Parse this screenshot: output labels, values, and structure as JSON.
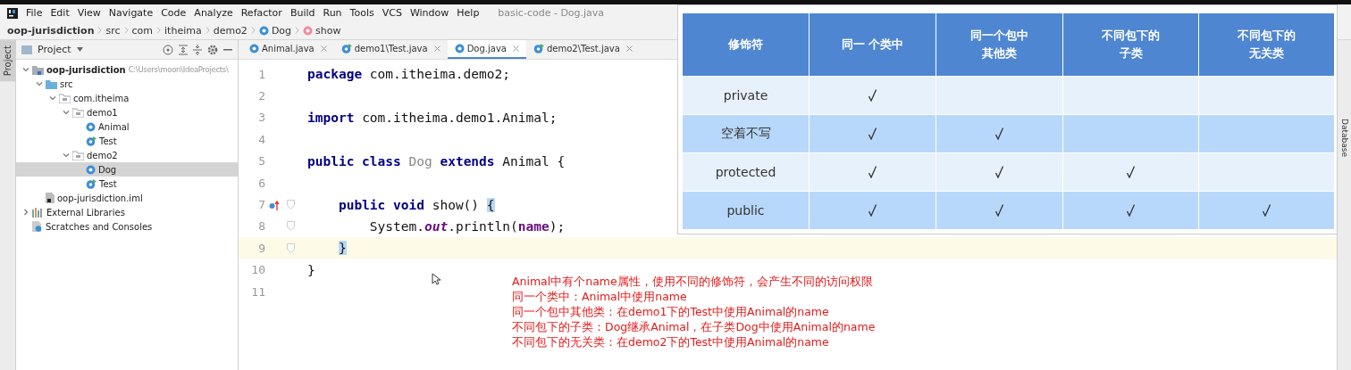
{
  "menu": [
    "File",
    "Edit",
    "View",
    "Navigate",
    "Code",
    "Analyze",
    "Refactor",
    "Build",
    "Run",
    "Tools",
    "VCS",
    "Window",
    "Help"
  ],
  "window": {
    "title": "basic-code - Dog.java"
  },
  "breadcrumb": [
    {
      "label": "oop-jurisdiction",
      "kind": "project"
    },
    {
      "label": "src",
      "kind": "dir"
    },
    {
      "label": "com",
      "kind": "dir"
    },
    {
      "label": "itheima",
      "kind": "dir"
    },
    {
      "label": "demo2",
      "kind": "dir"
    },
    {
      "label": "Dog",
      "kind": "class"
    },
    {
      "label": "show",
      "kind": "method"
    }
  ],
  "side_strip": {
    "label": "Project"
  },
  "right_strip": {
    "label": "Database"
  },
  "project_panel": {
    "title": "Project",
    "tree": [
      {
        "label": "oop-jurisdiction",
        "path": "C:\\Users\\moon\\IdeaProjects\\",
        "kind": "module",
        "expanded": true,
        "selected": false,
        "children": [
          {
            "label": "src",
            "kind": "source",
            "expanded": true,
            "selected": false,
            "children": [
              {
                "label": "com.itheima",
                "kind": "package",
                "expanded": true,
                "selected": false,
                "children": [
                  {
                    "label": "demo1",
                    "kind": "package",
                    "expanded": true,
                    "selected": false,
                    "children": [
                      {
                        "label": "Animal",
                        "kind": "class",
                        "selected": false
                      },
                      {
                        "label": "Test",
                        "kind": "main",
                        "selected": false
                      }
                    ]
                  },
                  {
                    "label": "demo2",
                    "kind": "package",
                    "expanded": true,
                    "selected": false,
                    "children": [
                      {
                        "label": "Dog",
                        "kind": "class",
                        "selected": true
                      },
                      {
                        "label": "Test",
                        "kind": "main",
                        "selected": false
                      }
                    ]
                  }
                ]
              }
            ]
          },
          {
            "label": "oop-jurisdiction.iml",
            "kind": "iml",
            "selected": false
          }
        ]
      },
      {
        "label": "External Libraries",
        "kind": "libraries",
        "expanded": false,
        "selected": false
      },
      {
        "label": "Scratches and Consoles",
        "kind": "scratches",
        "selected": false
      }
    ]
  },
  "tabs": [
    {
      "label": "Animal.java",
      "kind": "class",
      "selected": false
    },
    {
      "label": "demo1\\Test.java",
      "kind": "main",
      "selected": false
    },
    {
      "label": "Dog.java",
      "kind": "class",
      "selected": true
    },
    {
      "label": "demo2\\Test.java",
      "kind": "main",
      "selected": false
    }
  ],
  "editor": {
    "lines": [
      {
        "number": "1",
        "tokens": [
          {
            "text": "package",
            "kind": "keyword"
          },
          {
            "text": " com.itheima.demo2;",
            "kind": "plain"
          }
        ]
      },
      {
        "number": "2"
      },
      {
        "number": "3",
        "tokens": [
          {
            "text": "import",
            "kind": "keyword"
          },
          {
            "text": " com.itheima.demo1.Animal;",
            "kind": "plain"
          }
        ]
      },
      {
        "number": "4"
      },
      {
        "number": "5",
        "tokens": [
          {
            "text": "public class ",
            "kind": "keyword"
          },
          {
            "text": "Dog",
            "kind": "unused"
          },
          {
            "text": " extends",
            "kind": "keyword"
          },
          {
            "text": " Animal ",
            "kind": "plain"
          },
          {
            "text": "{",
            "kind": "plain"
          }
        ]
      },
      {
        "number": "6"
      },
      {
        "number": "7",
        "override": true,
        "fold": true,
        "tokens": [
          {
            "text": "    public void",
            "kind": "keyword"
          },
          {
            "text": " show() ",
            "kind": "plain"
          },
          {
            "text": "{",
            "kind": "match"
          }
        ]
      },
      {
        "number": "8",
        "fold": true,
        "tokens": [
          {
            "text": "        System.",
            "kind": "plain"
          },
          {
            "text": "out",
            "kind": "static"
          },
          {
            "text": ".println(",
            "kind": "plain"
          },
          {
            "text": "name",
            "kind": "field"
          },
          {
            "text": ");",
            "kind": "plain"
          }
        ]
      },
      {
        "number": "9",
        "fold": true,
        "current": true,
        "tokens": [
          {
            "text": "    }",
            "kind": "match"
          }
        ]
      },
      {
        "number": "10",
        "tokens": [
          {
            "text": "}",
            "kind": "plain"
          }
        ]
      },
      {
        "number": "11"
      }
    ]
  },
  "note": [
    "Animal中有个name属性，使用不同的修饰符，会产生不同的访问权限",
    "同一个类中：Animal中使用name",
    "同一个包中其他类：在demo1下的Test中使用Animal的name",
    "不同包下的子类：Dog继承Animal，在子类Dog中使用Animal的name",
    "不同包下的无关类：在demo2下的Test中使用Animal的name"
  ],
  "table": {
    "columns": [
      "修饰符",
      "同一 个类中",
      "同一个包中其他类",
      "不同包下的子类",
      "不同包下的无关类"
    ],
    "rows": [
      {
        "modifier": "private",
        "cells": [
          {
            "checked": true
          },
          {
            "checked": false
          },
          {
            "checked": false
          },
          {
            "checked": false
          }
        ]
      },
      {
        "modifier": "空着不写",
        "cells": [
          {
            "checked": true
          },
          {
            "checked": true
          },
          {
            "checked": false
          },
          {
            "checked": false
          }
        ]
      },
      {
        "modifier": "protected",
        "cells": [
          {
            "checked": true
          },
          {
            "checked": true
          },
          {
            "checked": true
          },
          {
            "checked": false
          }
        ]
      },
      {
        "modifier": "public",
        "cells": [
          {
            "checked": true
          },
          {
            "checked": true
          },
          {
            "checked": true
          },
          {
            "checked": true
          }
        ]
      }
    ]
  }
}
